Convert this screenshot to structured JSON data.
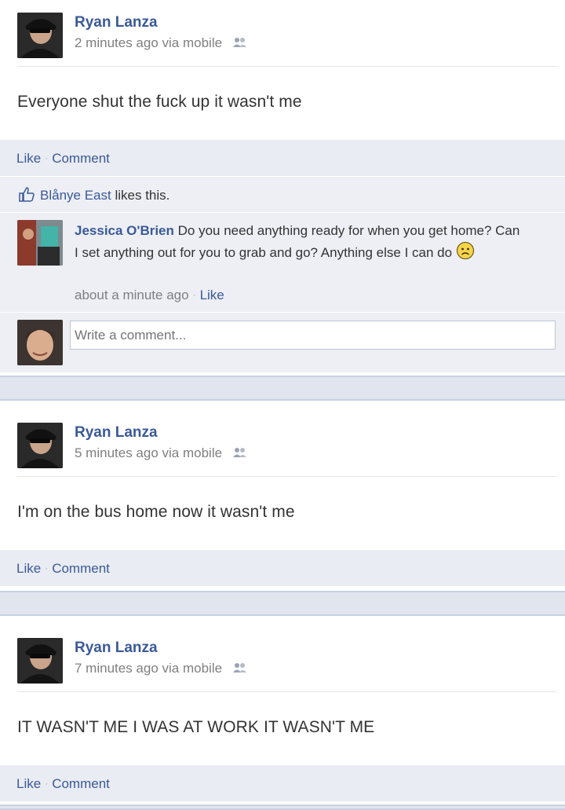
{
  "posts": [
    {
      "author": "Ryan Lanza",
      "time": "2 minutes ago via mobile",
      "status": "Everyone shut the fuck up it wasn't me",
      "like_label": "Like",
      "comment_label": "Comment",
      "likes": {
        "name": "Blånye East",
        "suffix": " likes this."
      },
      "comments": [
        {
          "author": "Jessica O'Brien",
          "text": " Do you need anything ready for when you get home? Can I set anything out for you to grab and go? Anything else I can do ",
          "time": "about a minute ago",
          "like_label": "Like"
        }
      ],
      "write_placeholder": "Write a comment..."
    },
    {
      "author": "Ryan Lanza",
      "time": "5 minutes ago via mobile",
      "status": "I'm on the bus home now it wasn't me",
      "like_label": "Like",
      "comment_label": "Comment"
    },
    {
      "author": "Ryan Lanza",
      "time": "7 minutes ago via mobile",
      "status": "IT WASN'T ME I WAS AT WORK IT WASN'T ME",
      "like_label": "Like",
      "comment_label": "Comment"
    }
  ],
  "colors": {
    "link": "#3b5998",
    "action_bar": "#e9ecf2",
    "comment_bg": "#edeff4",
    "separator": "#e1e5ee"
  }
}
